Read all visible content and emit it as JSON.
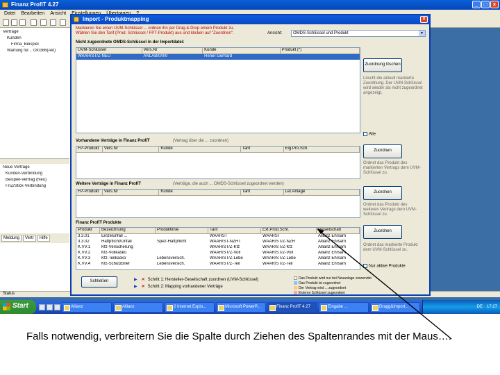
{
  "app": {
    "title": "Finanz ProfiT 4.27",
    "menu": [
      "Datei",
      "Bearbeiten",
      "Ansicht",
      "Einstellungen",
      "Übertragen",
      "?"
    ],
    "status_text": "Status"
  },
  "left_pane": {
    "tree": [
      "Verträge",
      "Kunden",
      "Firma_Beispiel",
      "Wartung für... 030386(Akt)"
    ],
    "lower_tree": [
      "Neue Verträge",
      "Kunden-Verbindung",
      "Beispiel-Vertrag (Neu)",
      "FrIZ/Stick-Verbindung"
    ],
    "tabs": [
      "Meldung",
      "Vertr",
      "Hilfe"
    ]
  },
  "dialog": {
    "title": "Import - Produktmapping",
    "instructions": [
      "Markieren Sie einen UVM-Schlüssel ... ordnen ihn per Drag & Drop einem Produkt zu.",
      "Wählen Sie den Tarif (Prod. Schlüssel / FPT-Produkt) aus und klicken auf \"Zuordnen\"."
    ],
    "ansicht_label": "Ansicht:",
    "ansicht_value": "OMDS-Schlüssel und Produkt",
    "sections": [
      {
        "label": "Nicht zugeordnete OMDS-Schlüssel in der Importdatei:",
        "columns": [
          "UVM-Schlüssel",
          "Vers.Nr",
          "Kunde",
          "Produkt (*)"
        ],
        "rows": [
          [
            "WAAR/ST/Z-NEU",
            "ANLAB/0/0/0",
            "Hener Gerhard",
            ""
          ]
        ],
        "sub": ""
      },
      {
        "label": "Vorhandene Verträge in Finanz ProfiT",
        "columns": [
          "FP-Produkt",
          "Vers.Nr",
          "Kunde",
          "Tarif",
          "Eig.Pro.Sch."
        ],
        "rows": [],
        "sub": "(Vertrag über die ... zuordnen)"
      },
      {
        "label": "Weitere Verträge in Finanz ProfiT",
        "columns": [
          "FP-Produkt",
          "Vers.Nr",
          "Kunde",
          "Tarif",
          "Let.Anlage"
        ],
        "rows": [],
        "sub": "(Verträge, die auch ... OMDS-Schlüssel zugeordnet werden)"
      },
      {
        "label": "Finanz ProfiT Produkte",
        "columns": [
          "Produkt",
          "Bezeichnung",
          "Produktlinie",
          "Tarif",
          "Ext.Prod.Schl.",
          "Gesellschaft"
        ],
        "rows": [
          [
            "3.3.01",
            "Einzelunfall ...",
            "",
            "WAARST",
            "WAARST",
            "Allianz Ehrsam"
          ],
          [
            "3.3.02",
            "Haftpflicht/Unfall",
            "Spez-Haftpflicht",
            "WAAR/ST-NZHT",
            "WAAR/ST/Z-NZH",
            "Allianz Ehrsam"
          ],
          [
            "K.VV.1",
            "Kfz-Versicherung",
            "",
            "WAAR/ST/Z-Kfz",
            "WAAR/ST/Z-Kfz",
            "Allianz Ehrsam"
          ],
          [
            "K.VV.2",
            "Kfz-Vollkasko",
            "",
            "WAAR/ST/Z-Voll",
            "WAAR/ST/Z-Voll",
            "Allianz Ehrsam"
          ],
          [
            "K.VV.3",
            "Kfz-Teilkasko",
            "Lebensversich.",
            "WAAR/ST/Z-Lebe",
            "WAAR/ST/Z-Lebe",
            "Allianz Ehrsam"
          ],
          [
            "K.VV.4",
            "Kfz-Schutzbrief",
            "Lebensversich.",
            "WAAR/ST/Z-Teil",
            "WAAR/ST/Z-Teil",
            "Allianz Ehrsam"
          ]
        ],
        "sub": ""
      }
    ],
    "buttons": {
      "zuordnung_loeschen": "Zuordnung löschen",
      "zuordnen1": "Zuordnen",
      "zuordnen2": "Zuordnen",
      "zuordnen3": "Zuordnen",
      "schliessen": "Schließen"
    },
    "descriptions": [
      "Löscht die aktuell markierte Zuordnung. Der UVM-Schlüssel wird wieder als nicht zugeordnet angezeigt.",
      "Ordnet das Produkt des markierten Vertrags dem UVM-Schlüssel zu.",
      "Ordnet das Produkt des weiteren Vertrags dem UVM-Schlüssel zu.",
      "Ordnet das markierte Produkt dem UVM-Schlüssel zu."
    ],
    "checkbox_alle": "Alle",
    "checkbox_produkte": "Nur aktive Produkte",
    "steps": [
      "Schritt 1: Hersteller-Gesellschaft zuordnen (UVM-Schlüssel)",
      "Schritt 2: Mapping vorhandener Verträge"
    ],
    "legend": [
      "Das Produkt wird nur bei Neuanlage verwendet",
      "Das Produkt ist zugeordnet",
      "Der Vertrag wird ... zugeordnet",
      "Externe Schlüssel zugeordnet"
    ]
  },
  "taskbar": {
    "start": "Start",
    "tasks": [
      "Allianz",
      "Allianz",
      "2 Internet Explo...",
      "Microsoft PowerP...",
      "Finanz ProfiT 4.27",
      "Eingabe ...",
      "Dragg&Import..."
    ],
    "lang": "DE",
    "clock": "17:27"
  },
  "caption": "Falls notwendig, verbreitern Sie die Spalte durch Ziehen des Spaltenrandes mit der Maus…."
}
